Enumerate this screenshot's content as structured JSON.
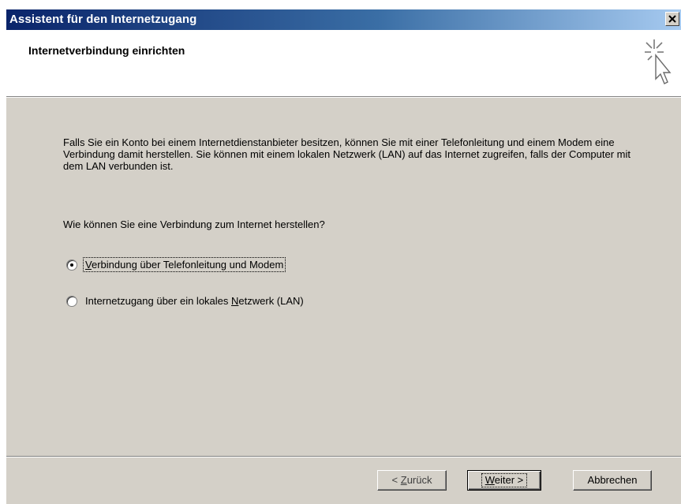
{
  "window": {
    "title": "Assistent für den Internetzugang",
    "close_glyph": "×"
  },
  "header": {
    "title": "Internetverbindung einrichten",
    "icon": "wizard-cursor-sparkle-icon"
  },
  "content": {
    "intro": "Falls Sie ein Konto bei einem Internetdienstanbieter besitzen, können Sie mit einer Telefonleitung und einem Modem eine Verbindung damit herstellen. Sie können mit einem lokalen Netzwerk (LAN) auf das Internet zugreifen, falls der Computer mit dem LAN verbunden ist.",
    "question": "Wie können Sie eine Verbindung zum Internet herstellen?",
    "options": [
      {
        "label_before": "",
        "label_accel": "V",
        "label_after": "erbindung über Telefonleitung und Modem",
        "selected": true
      },
      {
        "label_before": "Internetzugang über ein lokales ",
        "label_accel": "N",
        "label_after": "etzwerk (LAN)",
        "selected": false
      }
    ]
  },
  "buttons": {
    "back": {
      "prefix": "< ",
      "accel": "Z",
      "rest": "urück"
    },
    "next": {
      "accel": "W",
      "rest": "eiter >"
    },
    "cancel": {
      "label": "Abbrechen"
    }
  },
  "colors": {
    "titlebar_start": "#0a246a",
    "titlebar_end": "#a6caf0",
    "dialog_bg": "#d4d0c8"
  }
}
